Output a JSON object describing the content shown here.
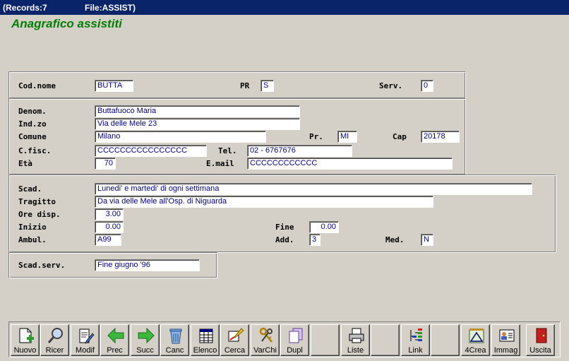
{
  "window": {
    "records": "(Records:7",
    "file": "File:ASSIST)"
  },
  "heading": "Anagrafico assistiti",
  "labels": {
    "cod_nome": "Cod.nome",
    "pr": "PR",
    "serv": "Serv.",
    "denom": "Denom.",
    "indzo": "Ind.zo",
    "comune": "Comune",
    "pr2": "Pr.",
    "cap": "Cap",
    "cfisc": "C.fisc.",
    "tel": "Tel.",
    "eta": "Età",
    "email": "E.mail",
    "scad": "Scad.",
    "tragitto": "Tragitto",
    "ore_disp": "Ore disp.",
    "inizio": "Inizio",
    "fine": "Fine",
    "ambul": "Ambul.",
    "add": "Add.",
    "med": "Med.",
    "scad_serv": "Scad.serv."
  },
  "fields": {
    "cod_nome": "BUTTA",
    "pr": "S",
    "serv": "0",
    "denom": "Buttafuoco Maria",
    "indzo": "Via delle Mele 23",
    "comune": "Milano",
    "pr2": "MI",
    "cap": "20178",
    "cfisc": "CCCCCCCCCCCCCCCC",
    "tel": "02 - 6767676",
    "eta": "70",
    "email": "CCCCCCCCCCCC",
    "scad": "Lunedi' e martedi' di ogni settimana",
    "tragitto": "Da via delle Mele all'Osp. di Niguarda",
    "ore_disp": "3.00",
    "inizio": "0.00",
    "fine": "0.00",
    "ambul": "A99",
    "add": "3",
    "med": "N",
    "scad_serv": "Fine giugno '96"
  },
  "toolbar": {
    "nuovo": "Nuovo",
    "ricer": "Ricer",
    "modif": "Modif",
    "prec": "Prec",
    "succ": "Succ",
    "canc": "Canc",
    "elenco": "Elenco",
    "cerca": "Cerca",
    "varchi": "VarChi",
    "dupl": "Dupl",
    "liste": "Liste",
    "link": "Link",
    "crea4": "4Crea",
    "immag": "Immag",
    "uscita": "Uscita"
  }
}
